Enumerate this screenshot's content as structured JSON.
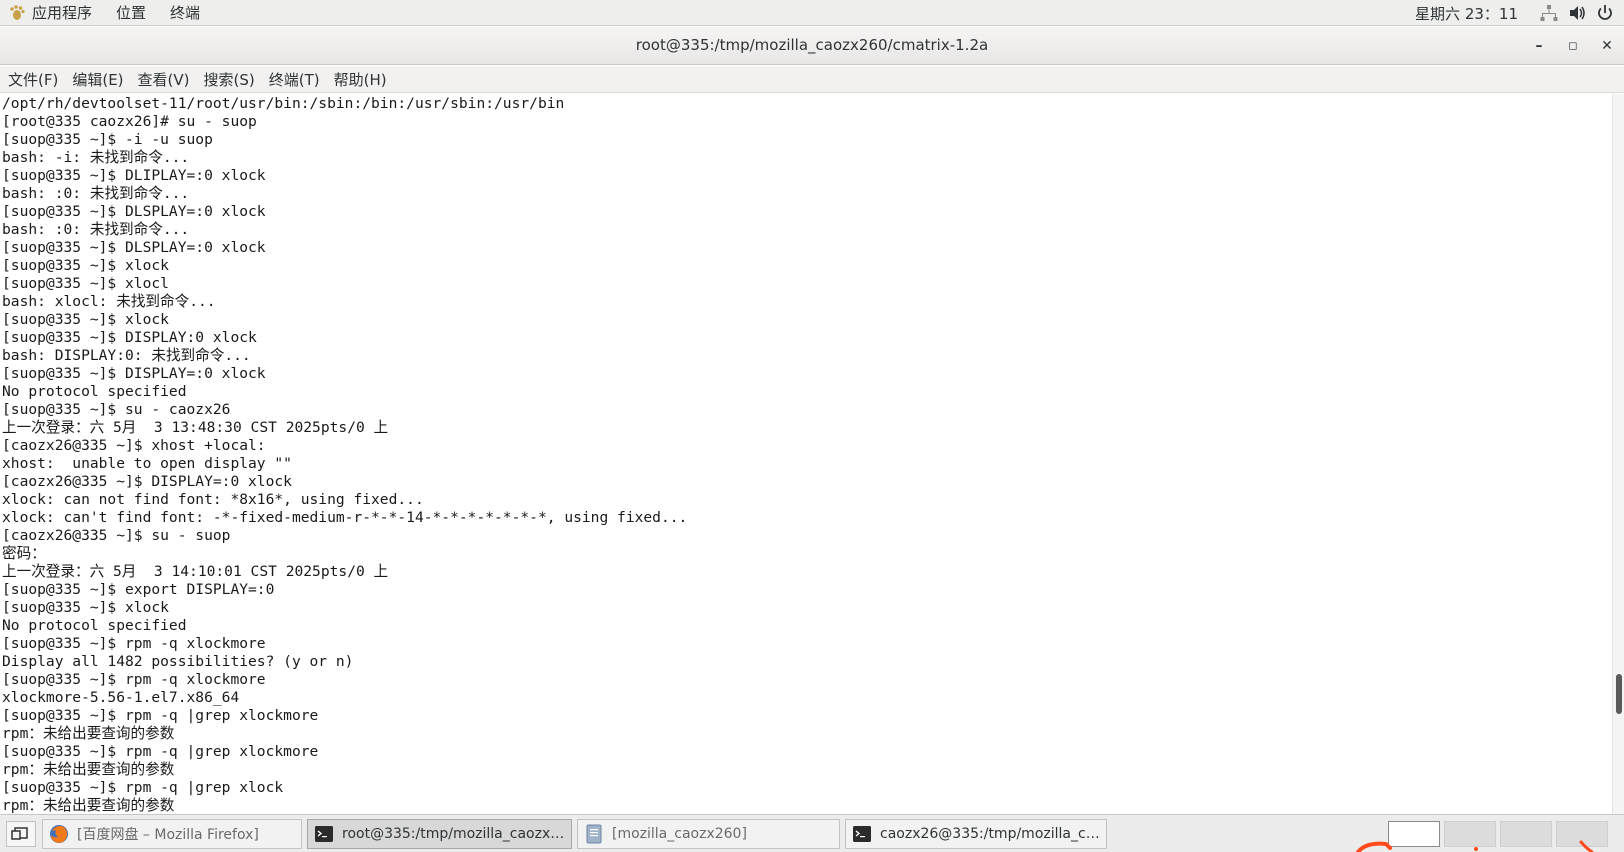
{
  "top_panel": {
    "apps_label": "应用程序",
    "places_label": "位置",
    "terminal_label": "终端",
    "clock": "星期六 23：11",
    "icons": [
      "network-icon",
      "volume-icon",
      "power-icon"
    ]
  },
  "window": {
    "title": "root@335:/tmp/mozilla_caozx260/cmatrix-1.2a",
    "minimize": "–",
    "maximize": "◻",
    "close": "✕"
  },
  "menu": [
    "文件(F)",
    "编辑(E)",
    "查看(V)",
    "搜索(S)",
    "终端(T)",
    "帮助(H)"
  ],
  "terminal_lines": [
    "/opt/rh/devtoolset-11/root/usr/bin:/sbin:/bin:/usr/sbin:/usr/bin",
    "[root@335 caozx26]# su - suop",
    "[suop@335 ~]$ -i -u suop",
    "bash: -i: 未找到命令...",
    "[suop@335 ~]$ DLIPLAY=:0 xlock",
    "bash: :0: 未找到命令...",
    "[suop@335 ~]$ DLSPLAY=:0 xlock",
    "bash: :0: 未找到命令...",
    "[suop@335 ~]$ DLSPLAY=:0 xlock",
    "[suop@335 ~]$ xlock",
    "[suop@335 ~]$ xlocl",
    "bash: xlocl: 未找到命令...",
    "[suop@335 ~]$ xlock",
    "[suop@335 ~]$ DISPLAY:0 xlock",
    "bash: DISPLAY:0: 未找到命令...",
    "[suop@335 ~]$ DISPLAY=:0 xlock",
    "No protocol specified",
    "[suop@335 ~]$ su - caozx26",
    "上一次登录：六 5月  3 13:48:30 CST 2025pts/0 上",
    "[caozx26@335 ~]$ xhost +local:",
    "xhost:  unable to open display \"\"",
    "[caozx26@335 ~]$ DISPLAY=:0 xlock",
    "xlock: can not find font: *8x16*, using fixed...",
    "xlock: can't find font: -*-fixed-medium-r-*-*-14-*-*-*-*-*-*-*, using fixed...",
    "[caozx26@335 ~]$ su - suop",
    "密码：",
    "上一次登录：六 5月  3 14:10:01 CST 2025pts/0 上",
    "[suop@335 ~]$ export DISPLAY=:0",
    "[suop@335 ~]$ xlock",
    "No protocol specified",
    "[suop@335 ~]$ rpm -q xlockmore",
    "Display all 1482 possibilities? (y or n)",
    "[suop@335 ~]$ rpm -q xlockmore",
    "xlockmore-5.56-1.el7.x86_64",
    "[suop@335 ~]$ rpm -q |grep xlockmore",
    "rpm：未给出要查询的参数",
    "[suop@335 ~]$ rpm -q |grep xlockmore",
    "rpm：未给出要查询的参数",
    "[suop@335 ~]$ rpm -q |grep xlock",
    "rpm：未给出要查询的参数"
  ],
  "taskbar": {
    "tasks": [
      {
        "label": "[百度网盘 – Mozilla Firefox]",
        "icon": "firefox-icon"
      },
      {
        "label": "root@335:/tmp/mozilla_caozx260/…",
        "icon": "terminal-icon"
      },
      {
        "label": "[mozilla_caozx260]",
        "icon": "folder-icon"
      },
      {
        "label": "caozx26@335:/tmp/mozilla_caozx-…",
        "icon": "terminal-icon"
      }
    ],
    "workspaces": 4,
    "current_workspace": 1
  },
  "colors": {
    "panel_bg": "#eeeeec",
    "terminal_bg": "#ffffff",
    "terminal_fg": "#1a1a1a",
    "scribble": "#ff4a1c"
  }
}
